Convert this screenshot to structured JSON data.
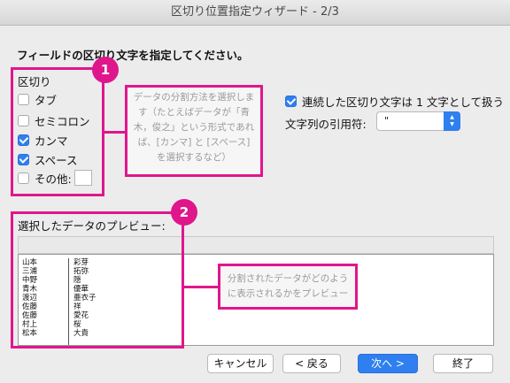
{
  "window": {
    "title": "区切り位置指定ウィザード - 2/3"
  },
  "instruction": "フィールドの区切り文字を指定してください。",
  "delimiters": {
    "group_label": "区切り",
    "tab": {
      "label": "タブ",
      "checked": false
    },
    "semicolon": {
      "label": "セミコロン",
      "checked": false
    },
    "comma": {
      "label": "カンマ",
      "checked": true
    },
    "space": {
      "label": "スペース",
      "checked": true
    },
    "other": {
      "label": "その他:",
      "checked": false,
      "value": ""
    }
  },
  "consecutive": {
    "label": "連続した区切り文字は 1 文字として扱う",
    "checked": true
  },
  "text_qualifier": {
    "label": "文字列の引用符:",
    "value": "\""
  },
  "preview": {
    "label": "選択したデータのプレビュー:",
    "rows": [
      [
        "山本",
        "彩芽"
      ],
      [
        "三浦",
        "拓弥"
      ],
      [
        "中野",
        "隠"
      ],
      [
        "青木",
        "優華"
      ],
      [
        "渡辺",
        "亜衣子"
      ],
      [
        "佐藤",
        "祥"
      ],
      [
        "佐藤",
        "愛花"
      ],
      [
        "村上",
        "桜"
      ],
      [
        "松本",
        "大貴"
      ]
    ]
  },
  "annotations": {
    "badge1": "1",
    "badge2": "2",
    "callout1": "データの分割方法を選択します（たとえばデータが「青木，俊之」という形式であれば、[カンマ] と [スペース] を選択するなど）",
    "callout2": "分割されたデータがどのように表示されるかをプレビュー",
    "accent_color": "#e0168c"
  },
  "buttons": {
    "cancel": "キャンセル",
    "back": "< 戻る",
    "next": "次へ >",
    "finish": "終了"
  }
}
